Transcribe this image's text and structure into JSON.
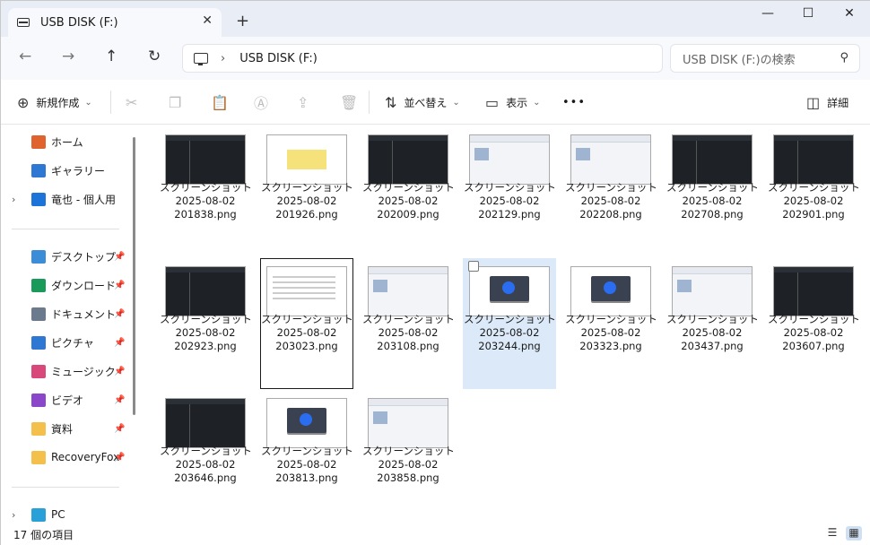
{
  "tab": {
    "title": "USB DISK (F:)",
    "close": "✕",
    "new_tab": "+"
  },
  "window": {
    "minimize": "—",
    "maximize": "☐",
    "close": "✕"
  },
  "address": {
    "path": "USB DISK (F:)",
    "chevron": "›"
  },
  "search": {
    "placeholder": "USB DISK (F:)の検索"
  },
  "nav_buttons": {
    "back": "←",
    "forward": "→",
    "up": "↑",
    "refresh": "↻"
  },
  "toolbar": {
    "new_label": "新規作成",
    "sort_label": "並べ替え",
    "view_label": "表示",
    "more_label": "•••",
    "details_label": "詳細"
  },
  "sidebar": {
    "items": [
      {
        "label": "ホーム",
        "icon": "home-icon",
        "color": "#e0632e"
      },
      {
        "label": "ギャラリー",
        "icon": "gallery-icon",
        "color": "#2e78d3"
      },
      {
        "label": "竜也 - 個人用",
        "icon": "onedrive-icon",
        "color": "#1d74d8"
      },
      {
        "label": "デスクトップ",
        "icon": "desktop-icon",
        "color": "#3a8dd6"
      },
      {
        "label": "ダウンロード",
        "icon": "download-icon",
        "color": "#1a9a5a"
      },
      {
        "label": "ドキュメント",
        "icon": "documents-icon",
        "color": "#6b7a8c"
      },
      {
        "label": "ピクチャ",
        "icon": "pictures-icon",
        "color": "#2e78d3"
      },
      {
        "label": "ミュージック",
        "icon": "music-icon",
        "color": "#d9487a"
      },
      {
        "label": "ビデオ",
        "icon": "videos-icon",
        "color": "#8b47c9"
      },
      {
        "label": "資料",
        "icon": "folder-icon",
        "color": "#f2c04b"
      },
      {
        "label": "RecoveryFox",
        "icon": "folder-icon",
        "color": "#f2c04b"
      },
      {
        "label": "PC",
        "icon": "pc-icon",
        "color": "#2aa0d8"
      }
    ]
  },
  "files": [
    {
      "l1": "スクリーンショット",
      "l2": "2025-08-02",
      "l3": "201838.png",
      "thumb": "dark"
    },
    {
      "l1": "スクリーンショット",
      "l2": "2025-08-02",
      "l3": "201926.png",
      "thumb": "note"
    },
    {
      "l1": "スクリーンショット",
      "l2": "2025-08-02",
      "l3": "202009.png",
      "thumb": "dark"
    },
    {
      "l1": "スクリーンショット",
      "l2": "2025-08-02",
      "l3": "202129.png",
      "thumb": "win"
    },
    {
      "l1": "スクリーンショット",
      "l2": "2025-08-02",
      "l3": "202208.png",
      "thumb": "win"
    },
    {
      "l1": "スクリーンショット",
      "l2": "2025-08-02",
      "l3": "202708.png",
      "thumb": "dark"
    },
    {
      "l1": "スクリーンショット",
      "l2": "2025-08-02",
      "l3": "202901.png",
      "thumb": "dark"
    },
    {
      "l1": "スクリーンショット",
      "l2": "2025-08-02",
      "l3": "202923.png",
      "thumb": "dark"
    },
    {
      "l1": "スクリーンショット",
      "l2": "2025-08-02",
      "l3": "203023.png",
      "thumb": "doc"
    },
    {
      "l1": "スクリーンショット",
      "l2": "2025-08-02",
      "l3": "203108.png",
      "thumb": "win"
    },
    {
      "l1": "スクリーンショット",
      "l2": "2025-08-02",
      "l3": "203244.png",
      "thumb": "laptop"
    },
    {
      "l1": "スクリーンショット",
      "l2": "2025-08-02",
      "l3": "203323.png",
      "thumb": "laptop"
    },
    {
      "l1": "スクリーンショット",
      "l2": "2025-08-02",
      "l3": "203437.png",
      "thumb": "win"
    },
    {
      "l1": "スクリーンショット",
      "l2": "2025-08-02",
      "l3": "203607.png",
      "thumb": "dark"
    },
    {
      "l1": "スクリーンショット",
      "l2": "2025-08-02",
      "l3": "203646.png",
      "thumb": "dark"
    },
    {
      "l1": "スクリーンショット",
      "l2": "2025-08-02",
      "l3": "203813.png",
      "thumb": "laptop"
    },
    {
      "l1": "スクリーンショット",
      "l2": "2025-08-02",
      "l3": "203858.png",
      "thumb": "win"
    }
  ],
  "status": {
    "count": "17 個の項目"
  }
}
